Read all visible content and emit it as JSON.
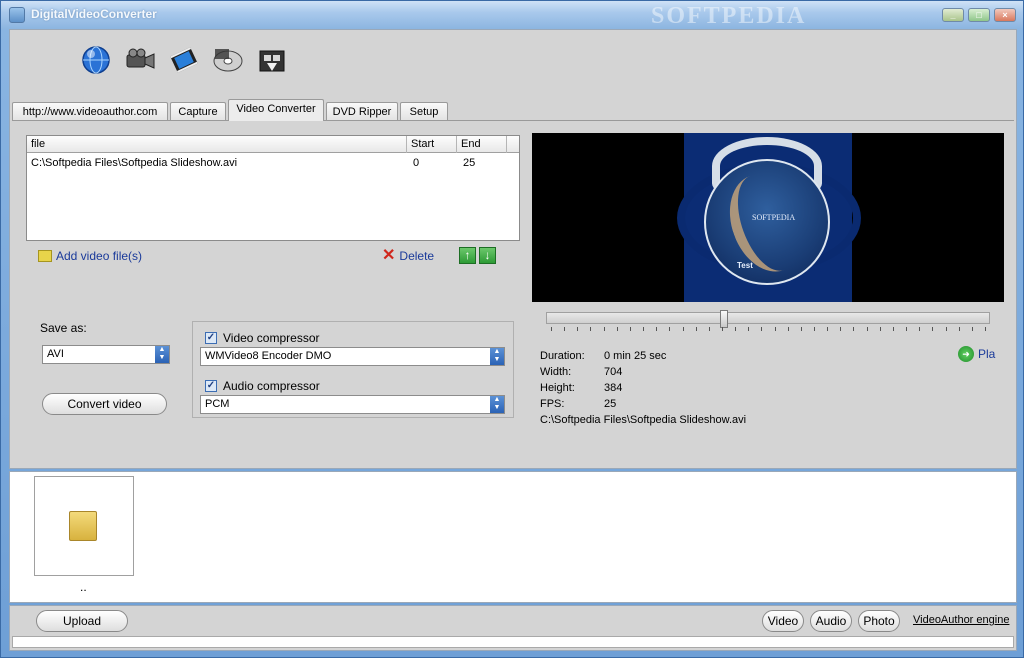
{
  "window": {
    "title": "DigitalVideoConverter",
    "watermark": "SOFTPEDIA"
  },
  "toolbar": {
    "icons": [
      "globe-icon",
      "camcorder-icon",
      "film-icon",
      "dvd-icon",
      "film-reel-icon"
    ]
  },
  "tabs": [
    {
      "label": "http://www.videoauthor.com",
      "active": false
    },
    {
      "label": "Capture",
      "active": false
    },
    {
      "label": "Video Converter",
      "active": true
    },
    {
      "label": "DVD Ripper",
      "active": false
    },
    {
      "label": "Setup",
      "active": false
    }
  ],
  "file_list": {
    "columns": [
      "file",
      "Start",
      "End"
    ],
    "rows": [
      {
        "file": "C:\\Softpedia Files\\Softpedia Slideshow.avi",
        "start": "0",
        "end": "25"
      }
    ]
  },
  "actions": {
    "add_label": "Add video file(s)",
    "delete_label": "Delete",
    "move_up": "↑",
    "move_down": "↓"
  },
  "save": {
    "label": "Save as:",
    "format": "AVI",
    "convert_label": "Convert video"
  },
  "compressors": {
    "video_label": "Video compressor",
    "video_checked": true,
    "video_value": "WMVideo8 Encoder DMO",
    "audio_label": "Audio compressor",
    "audio_checked": true,
    "audio_value": "PCM"
  },
  "preview": {
    "title_text": "SOFTPEDIA",
    "sub_text": "Test",
    "seek_position": 0.4
  },
  "info": {
    "duration_label": "Duration:",
    "duration_value": "0 min 25 sec",
    "width_label": "Width:",
    "width_value": "704",
    "height_label": "Height:",
    "height_value": "384",
    "fps_label": "FPS:",
    "fps_value": "25",
    "path": "C:\\Softpedia Files\\Softpedia Slideshow.avi",
    "play_label": "Pla"
  },
  "file_pane": {
    "caption": ".."
  },
  "bottom": {
    "upload_label": "Upload",
    "video_label": "Video",
    "audio_label": "Audio",
    "photo_label": "Photo",
    "engine_label": "VideoAuthor engine"
  },
  "colors": {
    "accent": "#2a62b5",
    "link": "#1a3a9a",
    "delete": "#d0261b",
    "arrow": "#2d9a35"
  }
}
